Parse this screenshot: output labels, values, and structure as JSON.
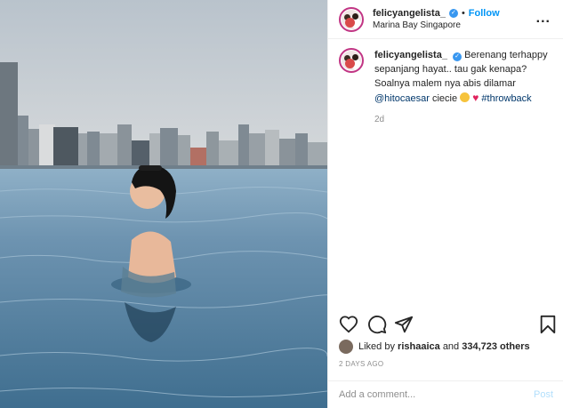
{
  "header": {
    "username": "felicyangelista_",
    "separator": "•",
    "follow_label": "Follow",
    "location": "Marina Bay Singapore",
    "more_label": "..."
  },
  "caption": {
    "username": "felicyangelista_",
    "text": "Berenang terhappy sepanjang hayat.. tau gak kenapa? Soalnya malem nya abis dilamar",
    "mention": "@hitocaesar",
    "after_mention": "ciecie",
    "hashtag": "#throwback",
    "age": "2d"
  },
  "likes": {
    "prefix": "Liked by",
    "liker": "rishaaica",
    "middle": "and",
    "count": "334,723 others"
  },
  "timestamp": "2 DAYS AGO",
  "comment_box": {
    "placeholder": "Add a comment...",
    "post_label": "Post"
  },
  "icons": {
    "like": "heart-icon",
    "comment": "comment-icon",
    "share": "share-icon",
    "save": "bookmark-icon",
    "verified": "verified-icon"
  },
  "colors": {
    "follow": "#0095f6",
    "verified": "#3897f0",
    "link": "#00376b",
    "muted": "#8e8e8e",
    "pool": "#5f87a3",
    "sky": "#c9ced3"
  }
}
